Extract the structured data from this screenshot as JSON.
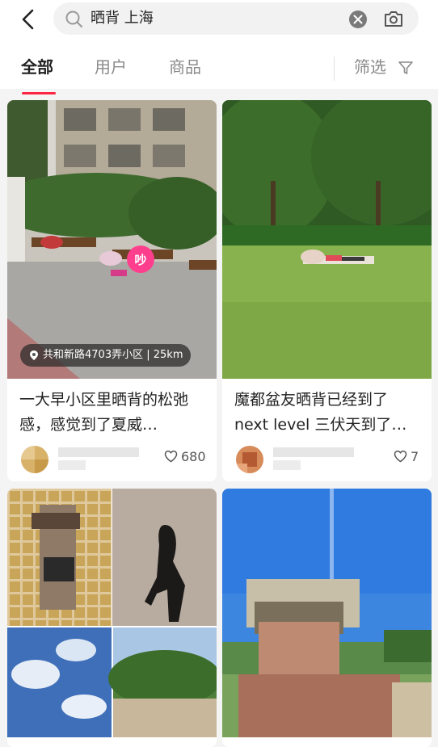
{
  "search": {
    "query": "晒背 上海"
  },
  "icons": {
    "back": "chevron-left-icon",
    "search": "magnifier-icon",
    "clear": "close-circle-icon",
    "camera": "camera-search-icon",
    "filter": "filter-funnel-icon",
    "like": "heart-outline-icon",
    "location": "location-pin-icon"
  },
  "tabs": [
    {
      "label": "全部",
      "active": true
    },
    {
      "label": "用户",
      "active": false
    },
    {
      "label": "商品",
      "active": false
    }
  ],
  "filter": {
    "label": "筛选"
  },
  "notes": [
    {
      "title": "一大早小区里晒背的松弛感，感觉到了夏威…",
      "likes": "680",
      "location": "共和新路4703弄小区",
      "distance": "25km",
      "sticker": "吵"
    },
    {
      "title": "魔都盆友晒背已经到了next level 三伏天到了…",
      "likes": "7"
    }
  ],
  "colors": {
    "accent": "#ff2442",
    "text": "#222222",
    "muted": "#8a8a8a"
  }
}
